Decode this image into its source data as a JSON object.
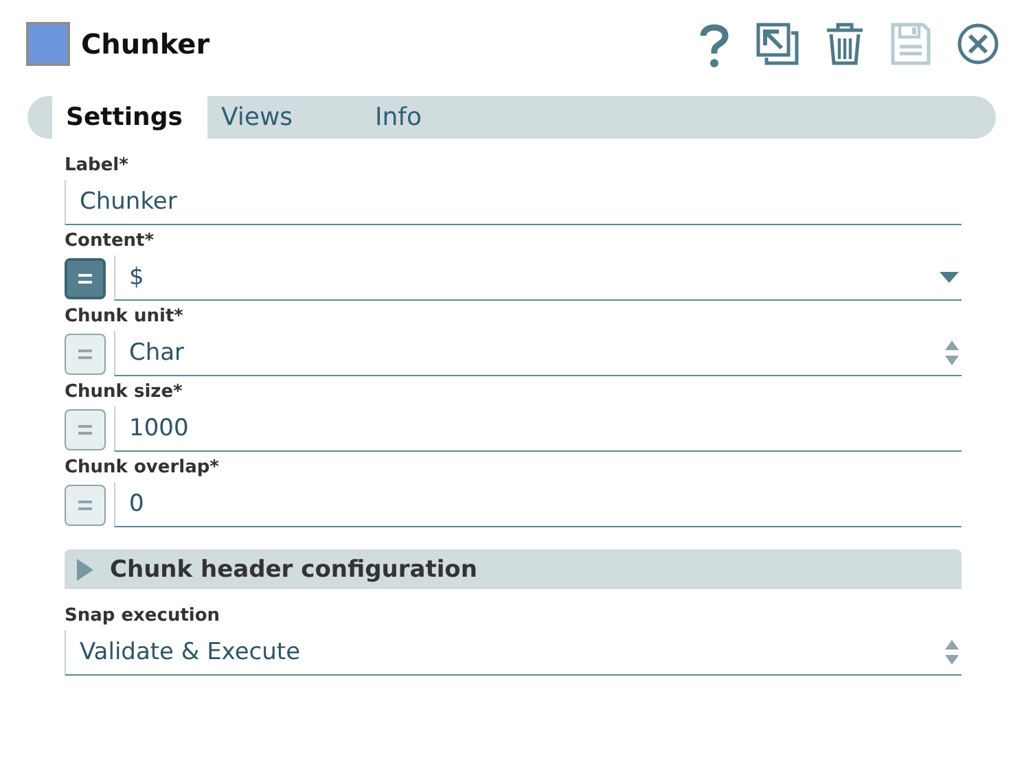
{
  "header": {
    "title": "Chunker",
    "color": "#6d96dc"
  },
  "toolbar": [
    {
      "kind": "help",
      "disabled": false
    },
    {
      "kind": "export",
      "disabled": false
    },
    {
      "kind": "delete",
      "disabled": false
    },
    {
      "kind": "save",
      "disabled": true
    },
    {
      "kind": "close",
      "disabled": false
    }
  ],
  "tabs": [
    {
      "label": "Settings",
      "selected": true
    },
    {
      "label": "Views",
      "selected": false
    },
    {
      "label": "Info",
      "selected": false
    }
  ],
  "fields": [
    {
      "kind": "text",
      "label": "Label*",
      "value": "Chunker"
    },
    {
      "kind": "dropdown",
      "label": "Content*",
      "value": "$",
      "expression": true
    },
    {
      "kind": "spinner",
      "label": "Chunk unit*",
      "value": "Char",
      "expression": false
    },
    {
      "kind": "text",
      "label": "Chunk size*",
      "value": "1000",
      "expression": false
    },
    {
      "kind": "text",
      "label": "Chunk overlap*",
      "value": "0",
      "expression": false
    },
    {
      "kind": "section",
      "label": "Chunk header configuration",
      "expanded": false
    },
    {
      "kind": "spinner",
      "label": "Snap execution",
      "value": "Validate & Execute"
    }
  ]
}
